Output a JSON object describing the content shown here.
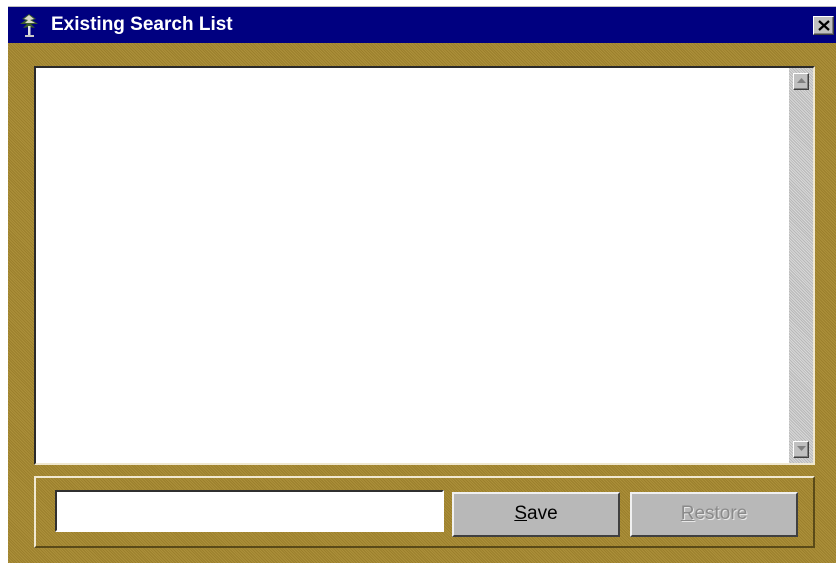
{
  "window": {
    "title": "Existing Search List",
    "title_icon": "tree-icon",
    "close_icon": "close-icon"
  },
  "colors": {
    "titlebar": "#000080",
    "client_background": "#a88a30",
    "list_background": "#ffffff",
    "button_face": "#b8b8b8",
    "disabled_text": "#8a8a8a"
  },
  "search_list": {
    "items": [],
    "scroll_up_icon": "arrow-up-icon",
    "scroll_down_icon": "arrow-down-icon"
  },
  "name_field": {
    "value": "",
    "placeholder": ""
  },
  "buttons": {
    "save": {
      "mnemonic": "S",
      "rest": "ave",
      "enabled": true
    },
    "restore": {
      "mnemonic": "R",
      "rest": "estore",
      "enabled": false
    }
  }
}
